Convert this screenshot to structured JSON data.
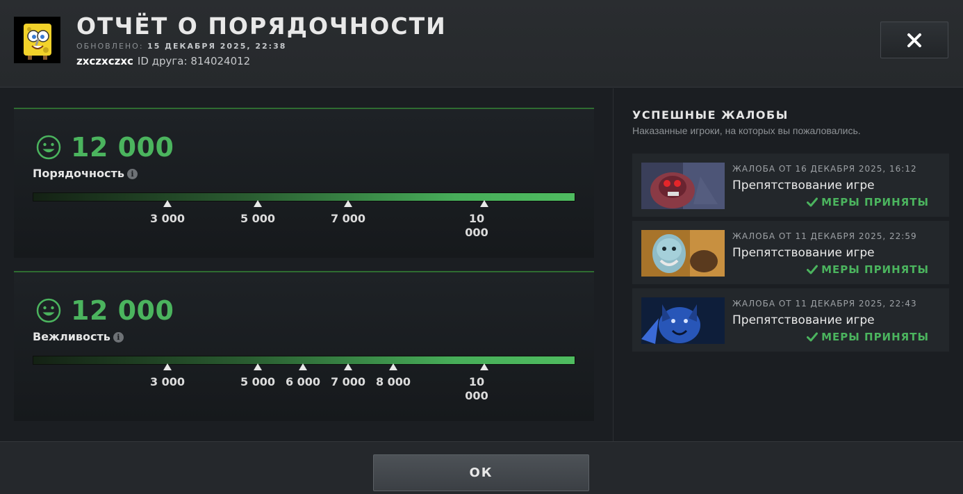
{
  "header": {
    "title": "ОТЧЁТ О ПОРЯДОЧНОСТИ",
    "updated_label": "ОБНОВЛЕНО:",
    "updated_date": "15 ДЕКАБРЯ 2025, 22:38",
    "username": "zxczxczxc",
    "friend_id_label": "ID друга: 814024012",
    "close_icon": "close-icon"
  },
  "metrics": [
    {
      "score": "12 000",
      "label": "Порядочность",
      "ticks": [
        "3 000",
        "5 000",
        "7 000",
        "10 000"
      ]
    },
    {
      "score": "12 000",
      "label": "Вежливость",
      "ticks": [
        "3 000",
        "5 000",
        "6 000",
        "7 000",
        "8 000",
        "10 000"
      ]
    }
  ],
  "reports_panel": {
    "title": "УСПЕШНЫЕ ЖАЛОБЫ",
    "subtitle": "Наказанные игроки, на которых вы пожаловались.",
    "reports": [
      {
        "date": "ЖАЛОБА ОТ 16 ДЕКАБРЯ 2025, 16:12",
        "reason": "Препятствование игре",
        "status": "МЕРЫ ПРИНЯТЫ"
      },
      {
        "date": "ЖАЛОБА ОТ 11 ДЕКАБРЯ 2025, 22:59",
        "reason": "Препятствование игре",
        "status": "МЕРЫ ПРИНЯТЫ"
      },
      {
        "date": "ЖАЛОБА ОТ 11 ДЕКАБРЯ 2025, 22:43",
        "reason": "Препятствование игре",
        "status": "МЕРЫ ПРИНЯТЫ"
      }
    ]
  },
  "footer": {
    "ok_label": "ОК"
  },
  "colors": {
    "accent_green": "#4bb45e",
    "background": "#1b1e22",
    "panel": "#1e2226"
  }
}
